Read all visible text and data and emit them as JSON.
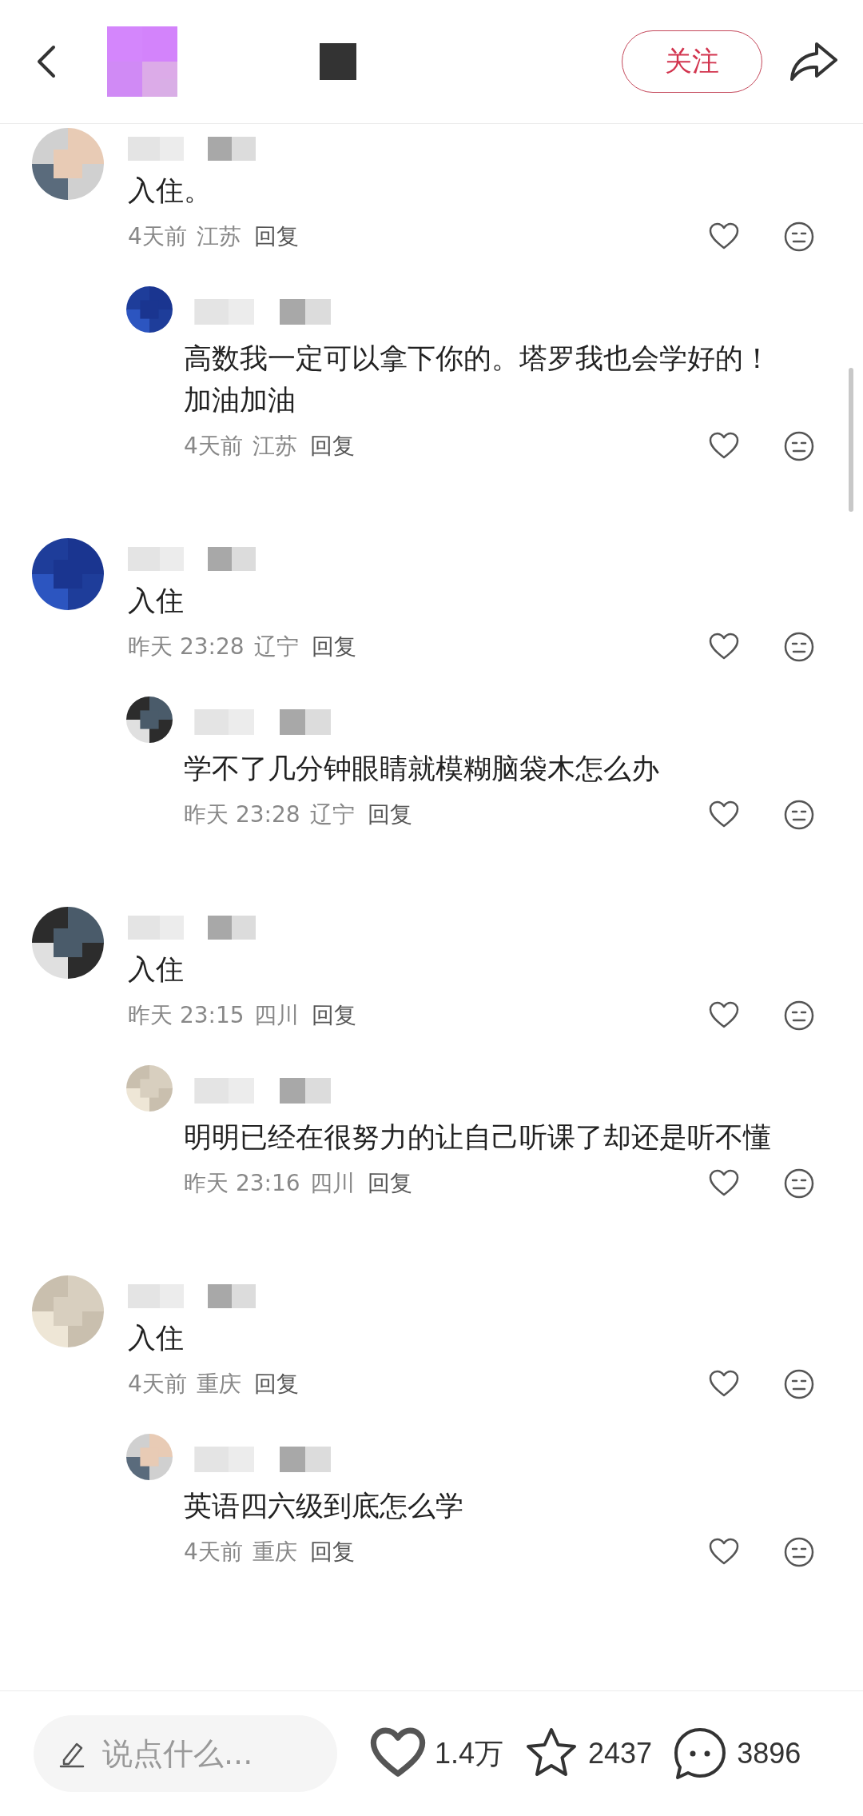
{
  "header": {
    "follow_label": "关注"
  },
  "comments": [
    {
      "text": "入住。",
      "time": "4天前",
      "region": "江苏",
      "reply_label": "回复",
      "replies": [
        {
          "text": "高数我一定可以拿下你的。塔罗我也会学好的！加油加油",
          "time": "4天前",
          "region": "江苏",
          "reply_label": "回复"
        }
      ]
    },
    {
      "text": "入住",
      "time": "昨天 23:28",
      "region": "辽宁",
      "reply_label": "回复",
      "replies": [
        {
          "text": "学不了几分钟眼睛就模糊脑袋木怎么办",
          "time": "昨天 23:28",
          "region": "辽宁",
          "reply_label": "回复"
        }
      ]
    },
    {
      "text": "入住",
      "time": "昨天 23:15",
      "region": "四川",
      "reply_label": "回复",
      "replies": [
        {
          "text": "明明已经在很努力的让自己听课了却还是听不懂",
          "time": "昨天 23:16",
          "region": "四川",
          "reply_label": "回复"
        }
      ]
    },
    {
      "text": "入住",
      "time": "4天前",
      "region": "重庆",
      "reply_label": "回复",
      "replies": [
        {
          "text": "英语四六级到底怎么学",
          "time": "4天前",
          "region": "重庆",
          "reply_label": "回复"
        }
      ]
    }
  ],
  "bottom_bar": {
    "input": {
      "placeholder": "说点什么..."
    },
    "likes": "1.4万",
    "favorites": "2437",
    "comments": "3896"
  }
}
